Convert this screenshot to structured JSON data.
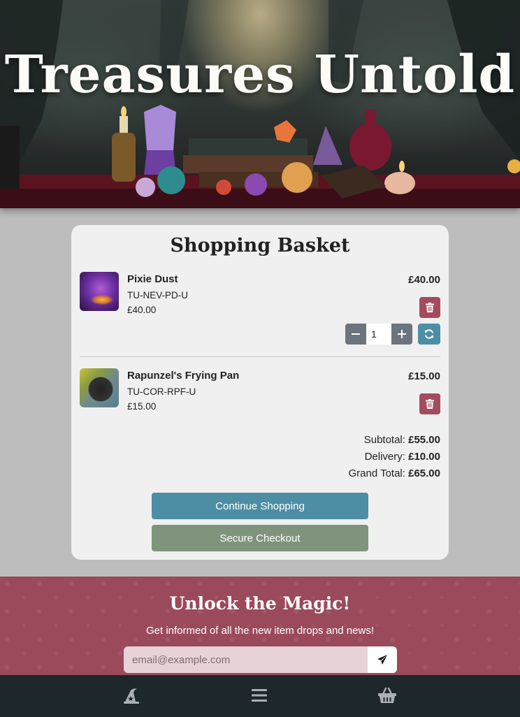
{
  "hero": {
    "title": "Treasures Untold",
    "image_icon": "mystic-treasure-table-banner"
  },
  "basket": {
    "title": "Shopping Basket",
    "items": [
      {
        "name": "Pixie Dust",
        "sku": "TU-NEV-PD-U",
        "unit_price": "£40.00",
        "line_total": "£40.00",
        "quantity": "1",
        "thumbnail_icon": "pixie-dust-thumbnail"
      },
      {
        "name": "Rapunzel's Frying Pan",
        "sku": "TU-COR-RPF-U",
        "unit_price": "£15.00",
        "line_total": "£15.00",
        "thumbnail_icon": "frying-pan-thumbnail"
      }
    ],
    "totals": {
      "subtotal_label": "Subtotal:",
      "subtotal_value": "£55.00",
      "delivery_label": "Delivery:",
      "delivery_value": "£10.00",
      "grand_total_label": "Grand Total:",
      "grand_total_value": "£65.00"
    },
    "continue_label": "Continue Shopping",
    "checkout_label": "Secure Checkout"
  },
  "newsletter": {
    "title": "Unlock the Magic!",
    "subtitle": "Get informed of all the new item drops and news!",
    "placeholder": "email@example.com",
    "send_icon": "paper-plane-icon"
  },
  "nav": {
    "home_icon": "wizard-hat-icon",
    "menu_icon": "hamburger-menu-icon",
    "basket_icon": "shopping-basket-icon"
  },
  "colors": {
    "delete": "#a34b5f",
    "primary": "#4e8ea4",
    "checkout": "#7e957c",
    "stepper": "#6c757d",
    "newsletter_bg": "#9a4a5b",
    "nav_bg": "#1e272c"
  }
}
